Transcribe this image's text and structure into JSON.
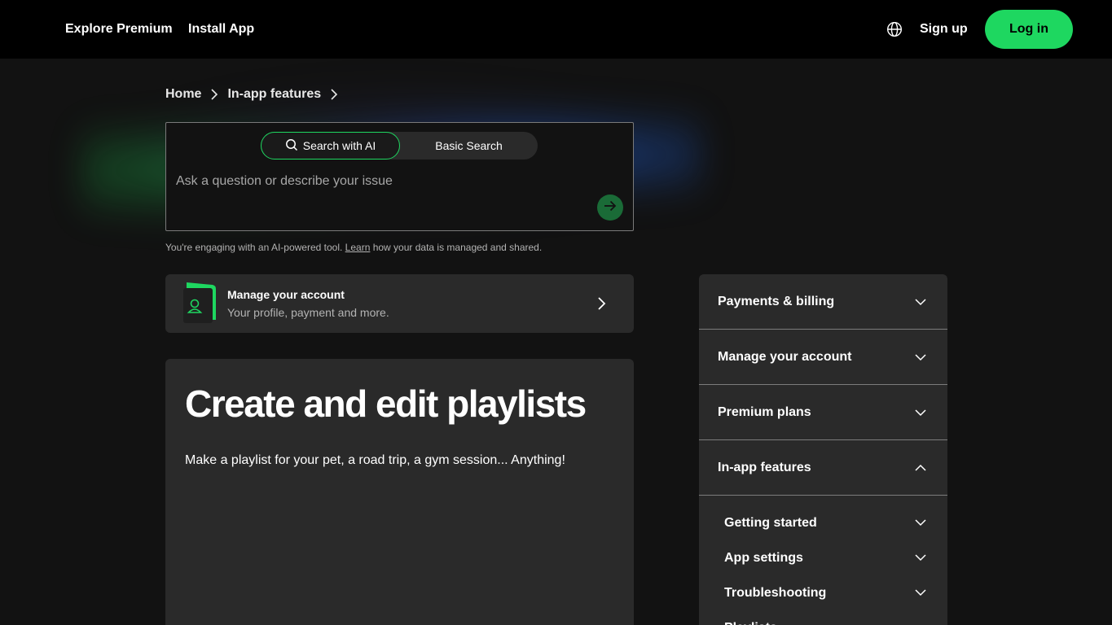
{
  "nav": {
    "explore_premium": "Explore Premium",
    "install_app": "Install App",
    "sign_up": "Sign up",
    "log_in": "Log in"
  },
  "breadcrumb": {
    "items": [
      "Home",
      "In-app features"
    ]
  },
  "search": {
    "mode_ai": "Search with AI",
    "mode_basic": "Basic Search",
    "placeholder": "Ask a question or describe your issue"
  },
  "disclaimer": {
    "before": "You're engaging with an AI-powered tool. ",
    "link": "Learn",
    "after": " how your data is managed and shared."
  },
  "account_card": {
    "title": "Manage your account",
    "subtitle": "Your profile, payment and more."
  },
  "article": {
    "title": "Create and edit playlists",
    "intro": "Make a playlist for your pet, a road trip, a gym session... Anything!"
  },
  "sidebar": {
    "sections": [
      {
        "label": "Payments & billing",
        "expanded": false
      },
      {
        "label": "Manage your account",
        "expanded": false
      },
      {
        "label": "Premium plans",
        "expanded": false
      },
      {
        "label": "In-app features",
        "expanded": true
      }
    ],
    "subitems": [
      {
        "label": "Getting started"
      },
      {
        "label": "App settings"
      },
      {
        "label": "Troubleshooting"
      },
      {
        "label": "Playlists"
      }
    ]
  },
  "colors": {
    "accent": "#1ed760",
    "background": "#121212",
    "surface": "#2a2a2a",
    "nav": "#000000"
  },
  "icons": [
    "globe-icon",
    "chevron-right-icon",
    "search-icon",
    "arrow-right-icon",
    "user-icon",
    "chevron-down-icon",
    "chevron-up-icon"
  ]
}
